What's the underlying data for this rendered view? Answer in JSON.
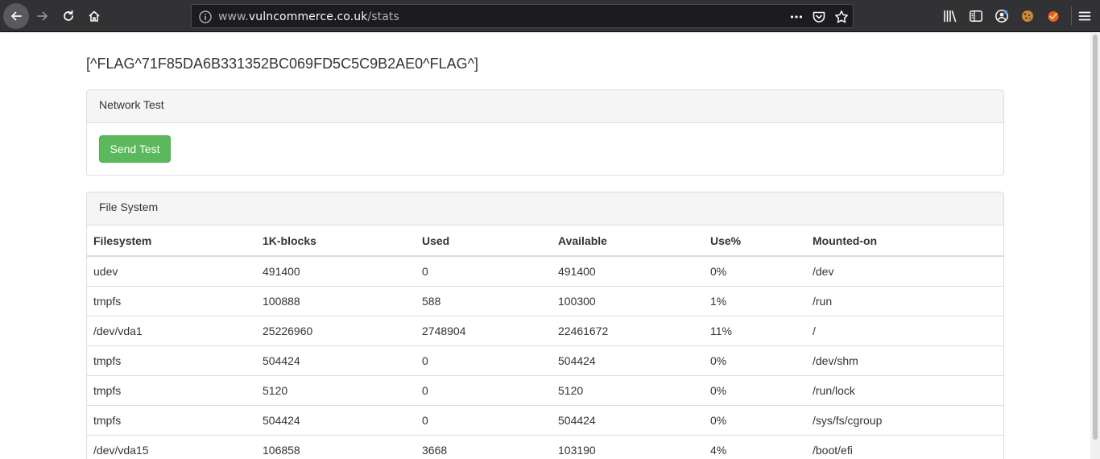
{
  "browser": {
    "url_prefix": "www.",
    "url_host": "vulncommerce.co.uk",
    "url_path": "/stats"
  },
  "page": {
    "flag": "[^FLAG^71F85DA6B331352BC069FD5C5C9B2AE0^FLAG^]"
  },
  "network_panel": {
    "heading": "Network Test",
    "button_label": "Send Test",
    "button_color": "#5cb85c"
  },
  "fs_panel": {
    "heading": "File System",
    "columns": [
      "Filesystem",
      "1K-blocks",
      "Used",
      "Available",
      "Use%",
      "Mounted-on"
    ],
    "rows": [
      [
        "udev",
        "491400",
        "0",
        "491400",
        "0%",
        "/dev"
      ],
      [
        "tmpfs",
        "100888",
        "588",
        "100300",
        "1%",
        "/run"
      ],
      [
        "/dev/vda1",
        "25226960",
        "2748904",
        "22461672",
        "11%",
        "/"
      ],
      [
        "tmpfs",
        "504424",
        "0",
        "504424",
        "0%",
        "/dev/shm"
      ],
      [
        "tmpfs",
        "5120",
        "0",
        "5120",
        "0%",
        "/run/lock"
      ],
      [
        "tmpfs",
        "504424",
        "0",
        "504424",
        "0%",
        "/sys/fs/cgroup"
      ],
      [
        "/dev/vda15",
        "106858",
        "3668",
        "103190",
        "4%",
        "/boot/efi"
      ]
    ]
  },
  "icons": {
    "back": "back-arrow-icon",
    "forward": "forward-arrow-icon",
    "reload": "reload-icon",
    "home": "home-icon",
    "info": "info-icon",
    "more": "more-dots-icon",
    "pocket": "pocket-icon",
    "bookmark": "star-icon",
    "library": "library-icon",
    "sidebar": "sidebar-icon",
    "account": "account-icon",
    "cookie": "cookie-icon",
    "extension": "extension-icon",
    "menu": "hamburger-menu-icon"
  }
}
